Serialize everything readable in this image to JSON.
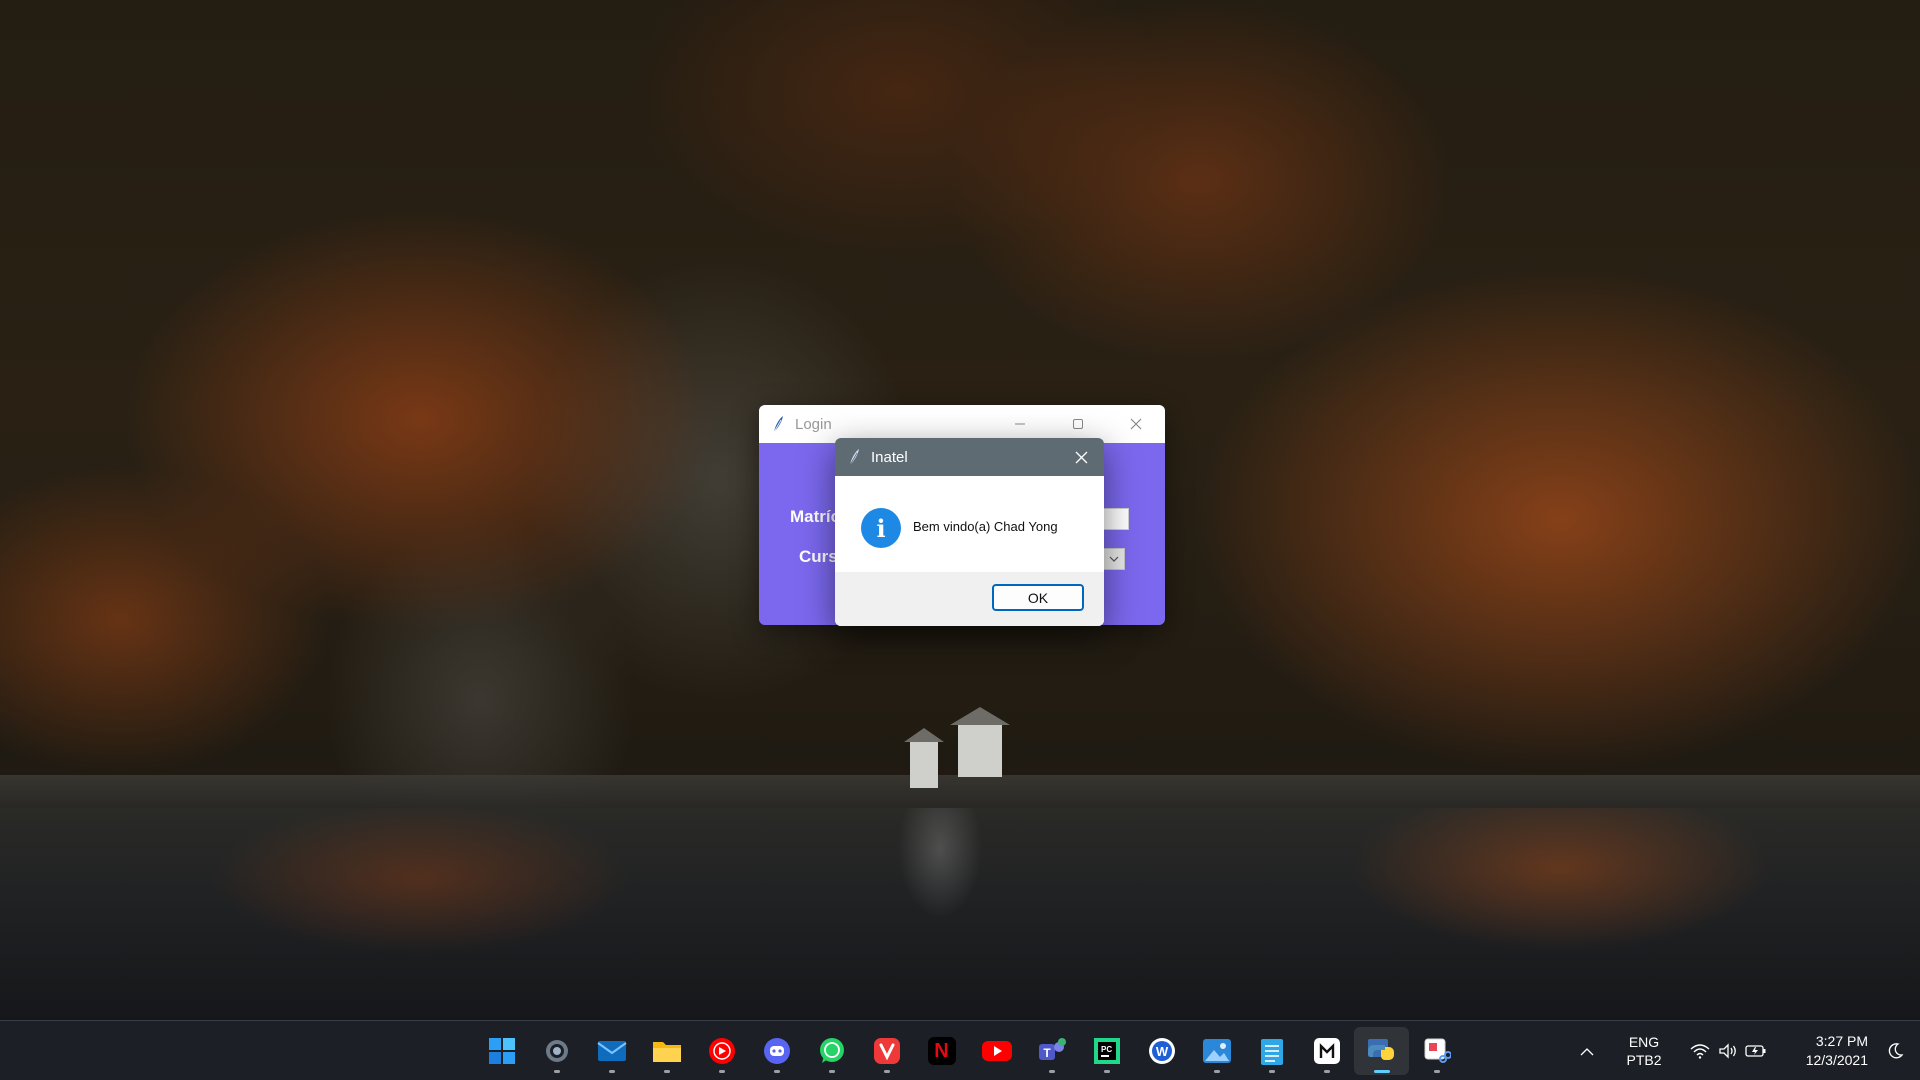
{
  "desktop": {
    "wallpaper": "autumn-forest-lake"
  },
  "login_window": {
    "title": "Login",
    "matricula_label": "Matríc",
    "curso_label": "Curs",
    "background_color": "#7b68ee"
  },
  "messagebox": {
    "title": "Inatel",
    "icon": "info-icon",
    "message": "Bem vindo(a) Chad Yong",
    "ok_label": "OK"
  },
  "taskbar": {
    "apps": [
      {
        "name": "start",
        "icon": "windows-start-icon",
        "running": false
      },
      {
        "name": "settings",
        "icon": "gear-icon",
        "running": true
      },
      {
        "name": "mail",
        "icon": "mail-icon",
        "running": true
      },
      {
        "name": "file-explorer",
        "icon": "folder-icon",
        "running": true
      },
      {
        "name": "youtube-music",
        "icon": "youtube-music-icon",
        "running": true
      },
      {
        "name": "discord",
        "icon": "discord-icon",
        "running": true
      },
      {
        "name": "whatsapp",
        "icon": "whatsapp-icon",
        "running": true
      },
      {
        "name": "vivaldi",
        "icon": "vivaldi-icon",
        "running": true
      },
      {
        "name": "netflix",
        "icon": "netflix-icon",
        "running": false
      },
      {
        "name": "youtube",
        "icon": "youtube-icon",
        "running": false
      },
      {
        "name": "teams",
        "icon": "teams-icon",
        "running": true
      },
      {
        "name": "pycharm",
        "icon": "pycharm-icon",
        "running": true
      },
      {
        "name": "word-reader",
        "icon": "word-icon",
        "running": false
      },
      {
        "name": "photos",
        "icon": "photos-icon",
        "running": true
      },
      {
        "name": "notepad",
        "icon": "notepad-icon",
        "running": true
      },
      {
        "name": "terminal-app",
        "icon": "terminal-icon",
        "running": true
      },
      {
        "name": "python",
        "icon": "python-icon",
        "running": true,
        "active": true
      },
      {
        "name": "snipping-tool",
        "icon": "snipping-tool-icon",
        "running": true
      }
    ],
    "tray": {
      "language_top": "ENG",
      "language_bottom": "PTB2",
      "time": "3:27 PM",
      "date": "12/3/2021"
    }
  }
}
